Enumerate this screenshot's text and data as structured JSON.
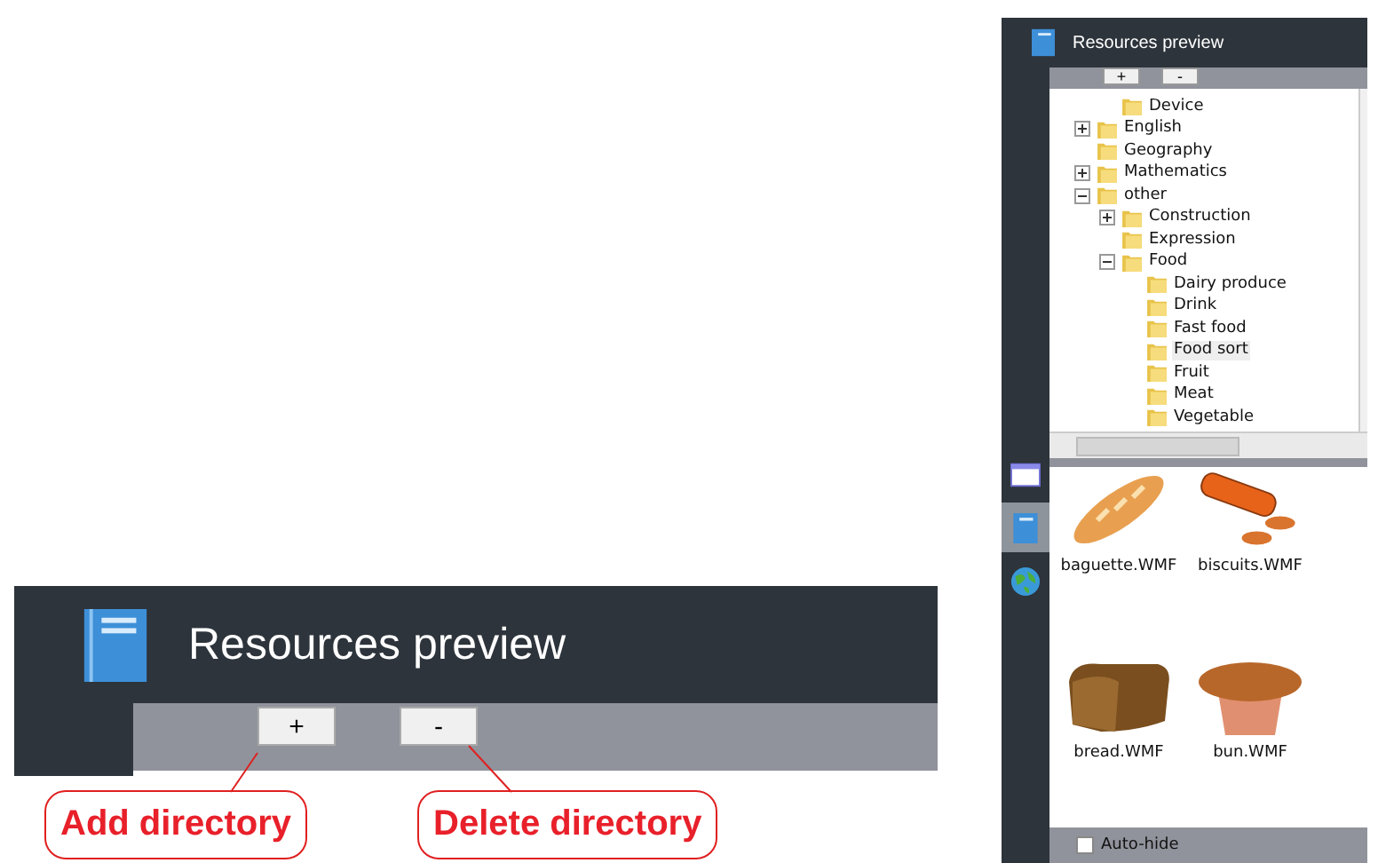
{
  "callout": {
    "title": "Resources preview",
    "buttons": [
      "+",
      "-"
    ],
    "annotations": [
      "Add directory",
      "Delete directory"
    ]
  },
  "panel": {
    "title": "Resources preview",
    "buttons": [
      "+",
      "-"
    ],
    "sidebar": [
      {
        "kind": "window",
        "selected": false
      },
      {
        "kind": "book",
        "selected": true
      },
      {
        "kind": "globe",
        "selected": false
      }
    ],
    "tree": {
      "clipped_parent": {
        "children": [
          {
            "label": "Device",
            "selected": false
          }
        ]
      },
      "items": [
        {
          "label": "English",
          "expanded": false,
          "selected": false
        },
        {
          "label": "Geography",
          "selected": false
        },
        {
          "label": "Mathematics",
          "expanded": false,
          "selected": false
        },
        {
          "label": "other",
          "expanded": true,
          "selected": false,
          "children": [
            {
              "label": "Construction",
              "expanded": false,
              "selected": false
            },
            {
              "label": "Expression",
              "selected": false
            },
            {
              "label": "Food",
              "expanded": true,
              "selected": false,
              "children": [
                {
                  "label": "Dairy produce",
                  "selected": false
                },
                {
                  "label": "Drink",
                  "selected": false
                },
                {
                  "label": "Fast food",
                  "selected": false
                },
                {
                  "label": "Food sort",
                  "selected": true
                },
                {
                  "label": "Fruit",
                  "selected": false
                },
                {
                  "label": "Meat",
                  "selected": false
                },
                {
                  "label": "Vegetable",
                  "selected": false
                }
              ]
            }
          ]
        }
      ]
    },
    "thumbnails": [
      {
        "kind": "baguette",
        "label": "baguette.WMF"
      },
      {
        "kind": "biscuits",
        "label": "biscuits.WMF"
      },
      {
        "kind": "bread",
        "label": "bread.WMF"
      },
      {
        "kind": "bun",
        "label": "bun.WMF"
      }
    ],
    "auto_hide": {
      "label": "Auto-hide",
      "checked": false
    }
  }
}
